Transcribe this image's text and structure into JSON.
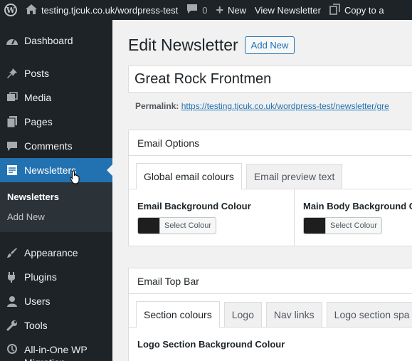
{
  "adminbar": {
    "site_url": "testing.tjcuk.co.uk/wordpress-test",
    "comments_count": "0",
    "new_label": "New",
    "view_label": "View Newsletter",
    "copy_label": "Copy to a"
  },
  "sidebar": {
    "items": [
      {
        "label": "Dashboard",
        "icon": "dashboard-icon"
      },
      {
        "label": "Posts",
        "icon": "pin-icon"
      },
      {
        "label": "Media",
        "icon": "media-icon"
      },
      {
        "label": "Pages",
        "icon": "pages-icon"
      },
      {
        "label": "Comments",
        "icon": "comment-icon"
      },
      {
        "label": "Newsletters",
        "icon": "newsletter-icon"
      },
      {
        "label": "Appearance",
        "icon": "paintbrush-icon"
      },
      {
        "label": "Plugins",
        "icon": "plugin-icon"
      },
      {
        "label": "Users",
        "icon": "users-icon"
      },
      {
        "label": "Tools",
        "icon": "wrench-icon"
      },
      {
        "label": "All-in-One WP Migration",
        "icon": "migration-icon"
      }
    ],
    "submenu": [
      "Newsletters",
      "Add New"
    ]
  },
  "main": {
    "title": "Edit Newsletter",
    "add_new": "Add New",
    "post_title": "Great Rock Frontmen",
    "permalink_label": "Permalink:",
    "permalink_url": "https://testing.tjcuk.co.uk/wordpress-test/newsletter/gre"
  },
  "email_options": {
    "title": "Email Options",
    "tabs": [
      "Global email colours",
      "Email preview text"
    ],
    "fields": [
      {
        "label": "Email Background Colour",
        "button": "Select Colour"
      },
      {
        "label": "Main Body Background C",
        "button": "Select Colour"
      }
    ]
  },
  "top_bar": {
    "title": "Email Top Bar",
    "tabs": [
      "Section colours",
      "Logo",
      "Nav links",
      "Logo section spa"
    ],
    "field_label": "Logo Section Background Colour"
  },
  "colors": {
    "admin_dark": "#1d2327",
    "accent": "#2271b1",
    "swatch": "#1e1e1e"
  }
}
